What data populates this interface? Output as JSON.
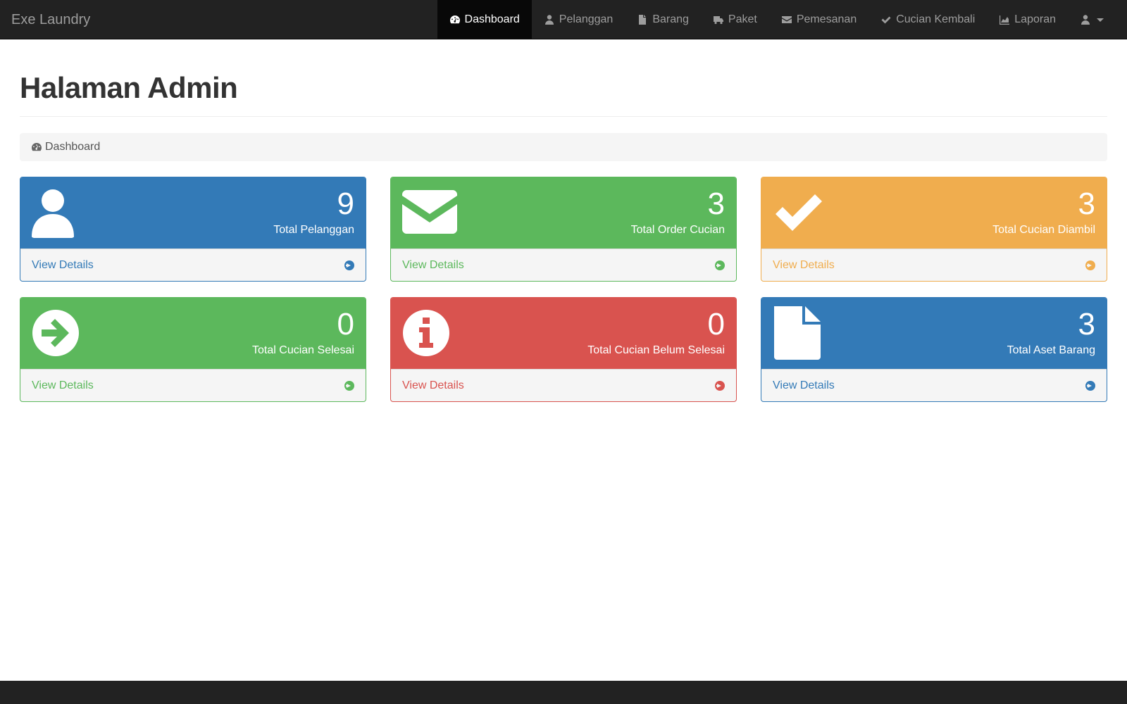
{
  "app": {
    "brand": "Exe Laundry"
  },
  "nav": {
    "items": [
      {
        "label": "Dashboard",
        "icon": "dashboard-icon",
        "active": true
      },
      {
        "label": "Pelanggan",
        "icon": "user-icon"
      },
      {
        "label": "Barang",
        "icon": "file-icon"
      },
      {
        "label": "Paket",
        "icon": "truck-icon"
      },
      {
        "label": "Pemesanan",
        "icon": "envelope-icon"
      },
      {
        "label": "Cucian Kembali",
        "icon": "check-icon"
      },
      {
        "label": "Laporan",
        "icon": "area-chart-icon"
      }
    ],
    "user_menu_icon": "user-icon"
  },
  "page": {
    "title": "Halaman Admin"
  },
  "breadcrumb": {
    "label": "Dashboard",
    "icon": "dashboard-icon"
  },
  "panels": [
    {
      "count": "9",
      "label": "Total Pelanggan",
      "footer": "View Details",
      "color": "#337ab7",
      "icon": "user-icon"
    },
    {
      "count": "3",
      "label": "Total Order Cucian",
      "footer": "View Details",
      "color": "#5cb85c",
      "icon": "envelope-icon"
    },
    {
      "count": "3",
      "label": "Total Cucian Diambil",
      "footer": "View Details",
      "color": "#f0ad4e",
      "icon": "check-icon"
    },
    {
      "count": "0",
      "label": "Total Cucian Selesai",
      "footer": "View Details",
      "color": "#5cb85c",
      "icon": "arrow-circle-right-icon"
    },
    {
      "count": "0",
      "label": "Total Cucian Belum Selesai",
      "footer": "View Details",
      "color": "#d9534f",
      "icon": "info-circle-icon"
    },
    {
      "count": "3",
      "label": "Total Aset Barang",
      "footer": "View Details",
      "color": "#337ab7",
      "icon": "file-icon"
    }
  ],
  "colors": {
    "navbar": "#222222",
    "primary": "#337ab7",
    "success": "#5cb85c",
    "warning": "#f0ad4e",
    "danger": "#d9534f"
  }
}
